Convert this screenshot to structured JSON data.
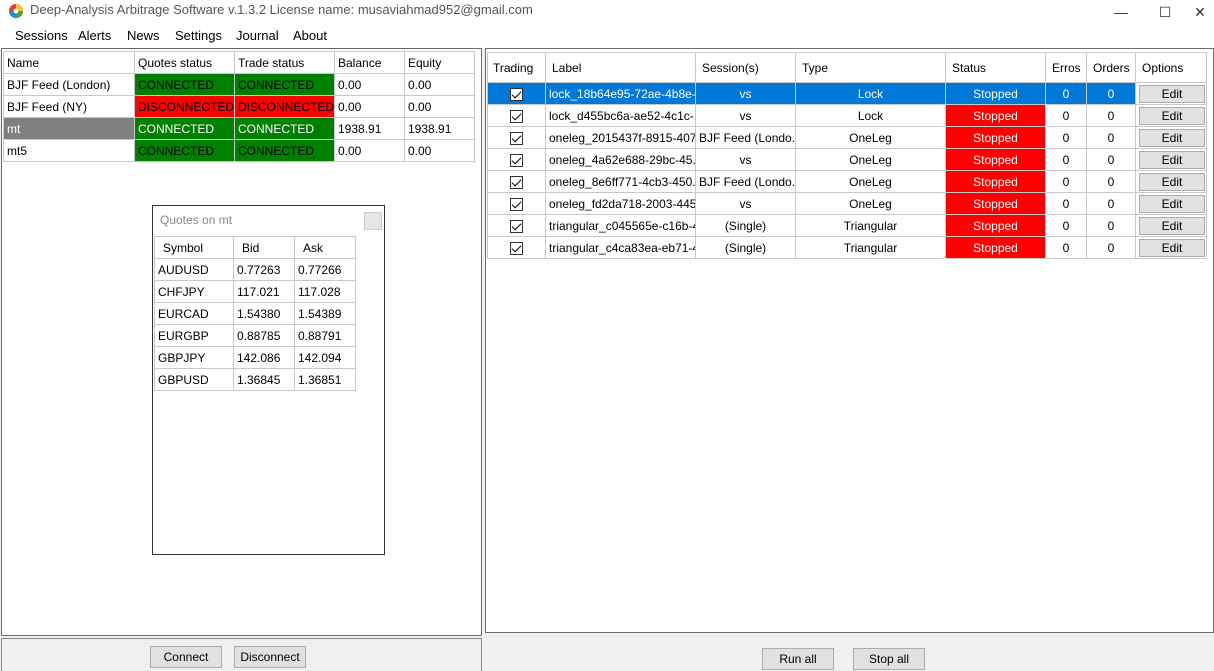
{
  "window": {
    "title": "Deep-Analysis Arbitrage Software v.1.3.2 License name: musaviahmad952@gmail.com",
    "minimize": "—",
    "maximize": "☐",
    "close": "✕"
  },
  "menu": [
    "Sessions",
    "Alerts",
    "News",
    "Settings",
    "Journal",
    "About"
  ],
  "sessions_table": {
    "headers": [
      "Name",
      "Quotes status",
      "Trade status",
      "Balance",
      "Equity"
    ],
    "rows": [
      {
        "name": "BJF Feed (London)",
        "quotes": "CONNECTED",
        "trade": "CONNECTED",
        "balance": "0.00",
        "equity": "0.00"
      },
      {
        "name": "BJF Feed (NY)",
        "quotes": "DISCONNECTED",
        "trade": "DISCONNECTED",
        "balance": "0.00",
        "equity": "0.00"
      },
      {
        "name": "mt",
        "quotes": "CONNECTED",
        "trade": "CONNECTED",
        "balance": "1938.91",
        "equity": "1938.91"
      },
      {
        "name": "mt5",
        "quotes": "CONNECTED",
        "trade": "CONNECTED",
        "balance": "0.00",
        "equity": "0.00"
      }
    ]
  },
  "quotes_window": {
    "title": "Quotes on mt",
    "headers": [
      "Symbol",
      "Bid",
      "Ask"
    ],
    "rows": [
      {
        "symbol": "AUDUSD",
        "bid": "0.77263",
        "ask": "0.77266"
      },
      {
        "symbol": "CHFJPY",
        "bid": "117.021",
        "ask": "117.028"
      },
      {
        "symbol": "EURCAD",
        "bid": "1.54380",
        "ask": "1.54389"
      },
      {
        "symbol": "EURGBP",
        "bid": "0.88785",
        "ask": "0.88791"
      },
      {
        "symbol": "GBPJPY",
        "bid": "142.086",
        "ask": "142.094"
      },
      {
        "symbol": "GBPUSD",
        "bid": "1.36845",
        "ask": "1.36851"
      }
    ]
  },
  "left_buttons": {
    "connect": "Connect",
    "disconnect": "Disconnect"
  },
  "strategies_table": {
    "headers": [
      "Trading",
      "Label",
      "Session(s)",
      "Type",
      "Status",
      "Erros",
      "Orders",
      "Options"
    ],
    "rows": [
      {
        "label": "lock_18b64e95-72ae-4b8e-...",
        "sessions": "vs",
        "type": "Lock",
        "status": "Stopped",
        "errors": "0",
        "orders": "0",
        "option": "Edit"
      },
      {
        "label": "lock_d455bc6a-ae52-4c1c-...",
        "sessions": "vs",
        "type": "Lock",
        "status": "Stopped",
        "errors": "0",
        "orders": "0",
        "option": "Edit"
      },
      {
        "label": "oneleg_2015437f-8915-407...",
        "sessions": "BJF Feed (Londo...",
        "type": "OneLeg",
        "status": "Stopped",
        "errors": "0",
        "orders": "0",
        "option": "Edit"
      },
      {
        "label": "oneleg_4a62e688-29bc-45...",
        "sessions": "vs",
        "type": "OneLeg",
        "status": "Stopped",
        "errors": "0",
        "orders": "0",
        "option": "Edit"
      },
      {
        "label": "oneleg_8e6ff771-4cb3-450...",
        "sessions": "BJF Feed (Londo...",
        "type": "OneLeg",
        "status": "Stopped",
        "errors": "0",
        "orders": "0",
        "option": "Edit"
      },
      {
        "label": "oneleg_fd2da718-2003-445...",
        "sessions": "vs",
        "type": "OneLeg",
        "status": "Stopped",
        "errors": "0",
        "orders": "0",
        "option": "Edit"
      },
      {
        "label": "triangular_c045565e-c16b-4...",
        "sessions": "(Single)",
        "type": "Triangular",
        "status": "Stopped",
        "errors": "0",
        "orders": "0",
        "option": "Edit"
      },
      {
        "label": "triangular_c4ca83ea-eb71-4...",
        "sessions": "(Single)",
        "type": "Triangular",
        "status": "Stopped",
        "errors": "0",
        "orders": "0",
        "option": "Edit"
      }
    ]
  },
  "right_buttons": {
    "run_all": "Run all",
    "stop_all": "Stop all"
  },
  "colors": {
    "connected": "#008000",
    "disconnected": "#ff0000",
    "selected": "#0078d7",
    "stopped": "#ff0000"
  }
}
